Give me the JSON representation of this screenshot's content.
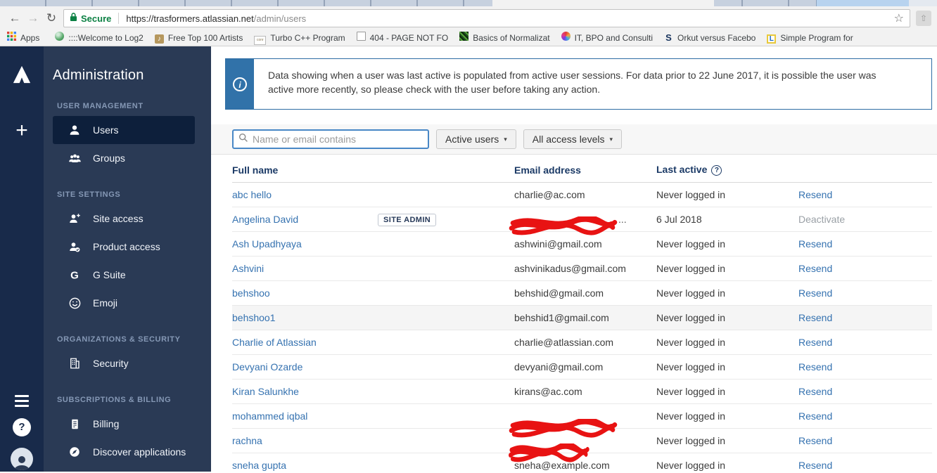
{
  "browser": {
    "secure_label": "Secure",
    "url_domain": "https://trasformers.atlassian.net",
    "url_path": "/admin/users",
    "apps_label": "Apps",
    "bookmarks": [
      {
        "label": "::::Welcome to Log2",
        "icon": "favicon-swirl"
      },
      {
        "label": "Free Top 100 Artists",
        "icon": "favicon-music"
      },
      {
        "label": "Turbo C++ Program",
        "icon": "favicon-conr"
      },
      {
        "label": "404 - PAGE NOT FO",
        "icon": "favicon-page"
      },
      {
        "label": "Basics of Normalizat",
        "icon": "favicon-pixels"
      },
      {
        "label": "IT, BPO and Consulti",
        "icon": "favicon-pinwheel"
      },
      {
        "label": "Orkut versus Facebo",
        "icon": "favicon-s"
      },
      {
        "label": "Simple Program for",
        "icon": "favicon-l"
      }
    ]
  },
  "sidebar": {
    "title": "Administration",
    "sections": [
      {
        "heading": "USER MANAGEMENT",
        "items": [
          {
            "label": "Users",
            "icon": "user-icon",
            "selected": true
          },
          {
            "label": "Groups",
            "icon": "group-icon"
          }
        ]
      },
      {
        "heading": "SITE SETTINGS",
        "items": [
          {
            "label": "Site access",
            "icon": "person-add-icon"
          },
          {
            "label": "Product access",
            "icon": "person-check-icon"
          },
          {
            "label": "G Suite",
            "icon": "gsuite-icon"
          },
          {
            "label": "Emoji",
            "icon": "emoji-icon"
          }
        ]
      },
      {
        "heading": "ORGANIZATIONS & SECURITY",
        "items": [
          {
            "label": "Security",
            "icon": "building-icon"
          }
        ]
      },
      {
        "heading": "SUBSCRIPTIONS & BILLING",
        "items": [
          {
            "label": "Billing",
            "icon": "billing-icon"
          },
          {
            "label": "Discover applications",
            "icon": "compass-icon"
          }
        ]
      }
    ]
  },
  "main": {
    "banner": {
      "text": "Data showing when a user was last active is populated from active user sessions. For data prior to 22 June 2017, it is possible the user was active more recently, so please check with the user before taking any action."
    },
    "filters": {
      "search_placeholder": "Name or email contains",
      "status_filter": "Active users",
      "access_filter": "All access levels"
    },
    "table": {
      "headers": {
        "name": "Full name",
        "email": "Email address",
        "last_active": "Last active"
      },
      "rows": [
        {
          "name": "abc hello",
          "email": "charlie@ac.com",
          "last_active": "Never logged in",
          "action": "Resend"
        },
        {
          "name": "Angelina David",
          "badge": "SITE ADMIN",
          "email": "",
          "redacted": true,
          "redact_tail": "...",
          "last_active": "6 Jul 2018",
          "action": "Deactivate",
          "action_muted": true
        },
        {
          "name": "Ash Upadhyaya",
          "email": "ashwini@gmail.com",
          "last_active": "Never logged in",
          "action": "Resend"
        },
        {
          "name": "Ashvini",
          "email": "ashvinikadus@gmail.com",
          "last_active": "Never logged in",
          "action": "Resend"
        },
        {
          "name": "behshoo",
          "email": "behshid@gmail.com",
          "last_active": "Never logged in",
          "action": "Resend"
        },
        {
          "name": "behshoo1",
          "email": "behshid1@gmail.com",
          "last_active": "Never logged in",
          "action": "Resend",
          "highlighted": true
        },
        {
          "name": "Charlie of Atlassian",
          "email": "charlie@atlassian.com",
          "last_active": "Never logged in",
          "action": "Resend"
        },
        {
          "name": "Devyani Ozarde",
          "email": "devyani@gmail.com",
          "last_active": "Never logged in",
          "action": "Resend"
        },
        {
          "name": "Kiran Salunkhe",
          "email": "kirans@ac.com",
          "last_active": "Never logged in",
          "action": "Resend"
        },
        {
          "name": "mohammed iqbal",
          "email": "",
          "redacted": true,
          "last_active": "Never logged in",
          "action": "Resend"
        },
        {
          "name": "rachna",
          "email": "",
          "redacted": true,
          "redact_small": true,
          "last_active": "Never logged in",
          "action": "Resend"
        },
        {
          "name": "sneha gupta",
          "email": "sneha@example.com",
          "last_active": "Never logged in",
          "action": "Resend"
        }
      ]
    }
  },
  "colors": {
    "rail_bg": "#182a4a",
    "panel_bg": "#2a3a55",
    "selected_item_bg": "#0d1f3b",
    "banner_blue": "#3172a9",
    "link_blue": "#3572b0",
    "secure_green": "#0b8043",
    "redaction_red": "#e81313"
  }
}
